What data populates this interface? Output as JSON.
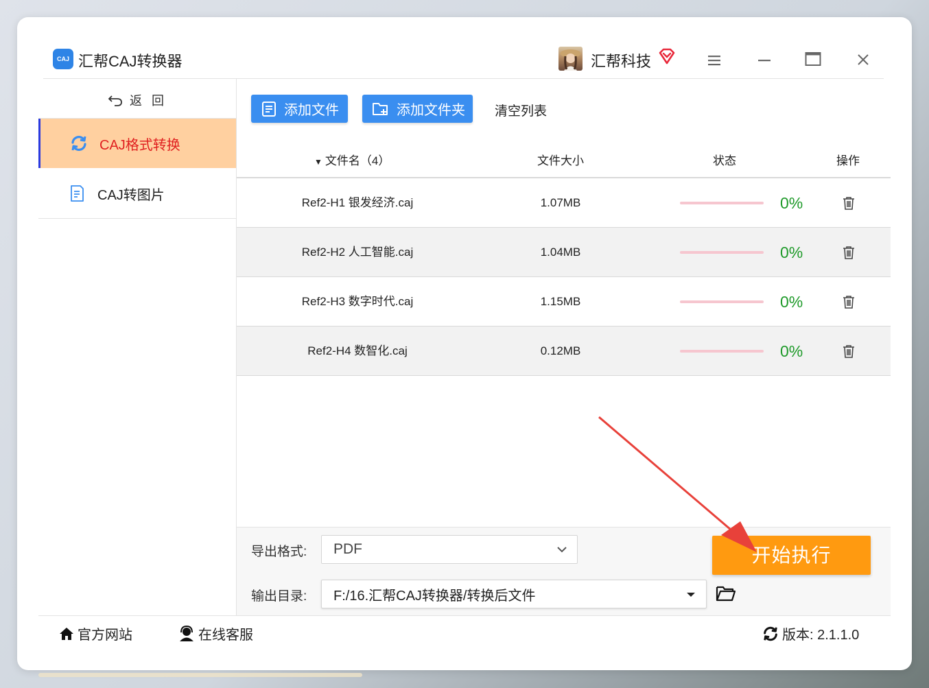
{
  "app": {
    "logo_text": "CAJ",
    "title": "汇帮CAJ转换器",
    "user_name": "汇帮科技"
  },
  "sidebar": {
    "back_label": "返回",
    "items": [
      {
        "label": "CAJ格式转换",
        "active": true,
        "icon": "refresh-icon"
      },
      {
        "label": "CAJ转图片",
        "active": false,
        "icon": "document-icon"
      }
    ]
  },
  "toolbar": {
    "add_file": "添加文件",
    "add_folder": "添加文件夹",
    "clear_list": "清空列表"
  },
  "table": {
    "headers": {
      "name": "文件名（4）",
      "size": "文件大小",
      "status": "状态",
      "action": "操作"
    },
    "rows": [
      {
        "name": "Ref2-H1 银发经济.caj",
        "size": "1.07MB",
        "progress": 0,
        "percent": "0%"
      },
      {
        "name": "Ref2-H2 人工智能.caj",
        "size": "1.04MB",
        "progress": 0,
        "percent": "0%"
      },
      {
        "name": "Ref2-H3 数字时代.caj",
        "size": "1.15MB",
        "progress": 0,
        "percent": "0%"
      },
      {
        "name": "Ref2-H4 数智化.caj",
        "size": "0.12MB",
        "progress": 0,
        "percent": "0%"
      }
    ]
  },
  "output": {
    "format_label": "导出格式:",
    "format_value": "PDF",
    "dir_label": "输出目录:",
    "dir_value": "F:/16.汇帮CAJ转换器/转换后文件",
    "start_button": "开始执行"
  },
  "footer": {
    "website": "官方网站",
    "support": "在线客服",
    "version": "版本: 2.1.1.0"
  },
  "colors": {
    "accent_blue": "#3a8ef0",
    "active_bg": "#ffd0a0",
    "active_text": "#e02020",
    "start_orange": "#ff9a10",
    "percent_green": "#1f9a2a",
    "arrow_red": "#e8413a"
  }
}
